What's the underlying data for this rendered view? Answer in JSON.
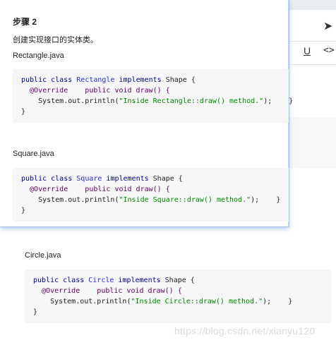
{
  "step": {
    "title": "步骤 2",
    "description": "创建实现接口的实体类。"
  },
  "files": [
    {
      "name": "Rectangle.java",
      "code": [
        {
          "kw1": "public class ",
          "cls": "Rectangle",
          "kw2": " implements ",
          "rest": "Shape {"
        },
        {
          "text": "  @Override    public void draw() {"
        },
        {
          "pre": "    System.out.println(",
          "str": "\"Inside Rectangle::draw() method.\"",
          "post": ");    }"
        },
        {
          "text": "}"
        }
      ]
    },
    {
      "name": "Square.java",
      "code": [
        {
          "kw1": "public class ",
          "cls": "Square",
          "kw2": " implements ",
          "rest": "Shape {"
        },
        {
          "text": "  @Override    public void draw() {"
        },
        {
          "pre": "    System.out.println(",
          "str": "\"Inside Square::draw() method.\"",
          "post": ");    }"
        },
        {
          "text": "}"
        }
      ]
    },
    {
      "name": "Circle.java",
      "code": [
        {
          "kw1": "public class ",
          "cls": "Circle",
          "kw2": " implements ",
          "rest": "Shape {"
        },
        {
          "text": "  @Override    public void draw() {"
        },
        {
          "pre": "    System.out.println(",
          "str": "\"Inside Circle::draw() method.\"",
          "post": ");    }"
        },
        {
          "text": "}"
        }
      ]
    }
  ],
  "background_toolbar": {
    "underline_label": "U",
    "code_icon": "code-icon",
    "send_icon": "send-icon"
  },
  "watermark": "https://blog.csdn.net/xianyu120"
}
